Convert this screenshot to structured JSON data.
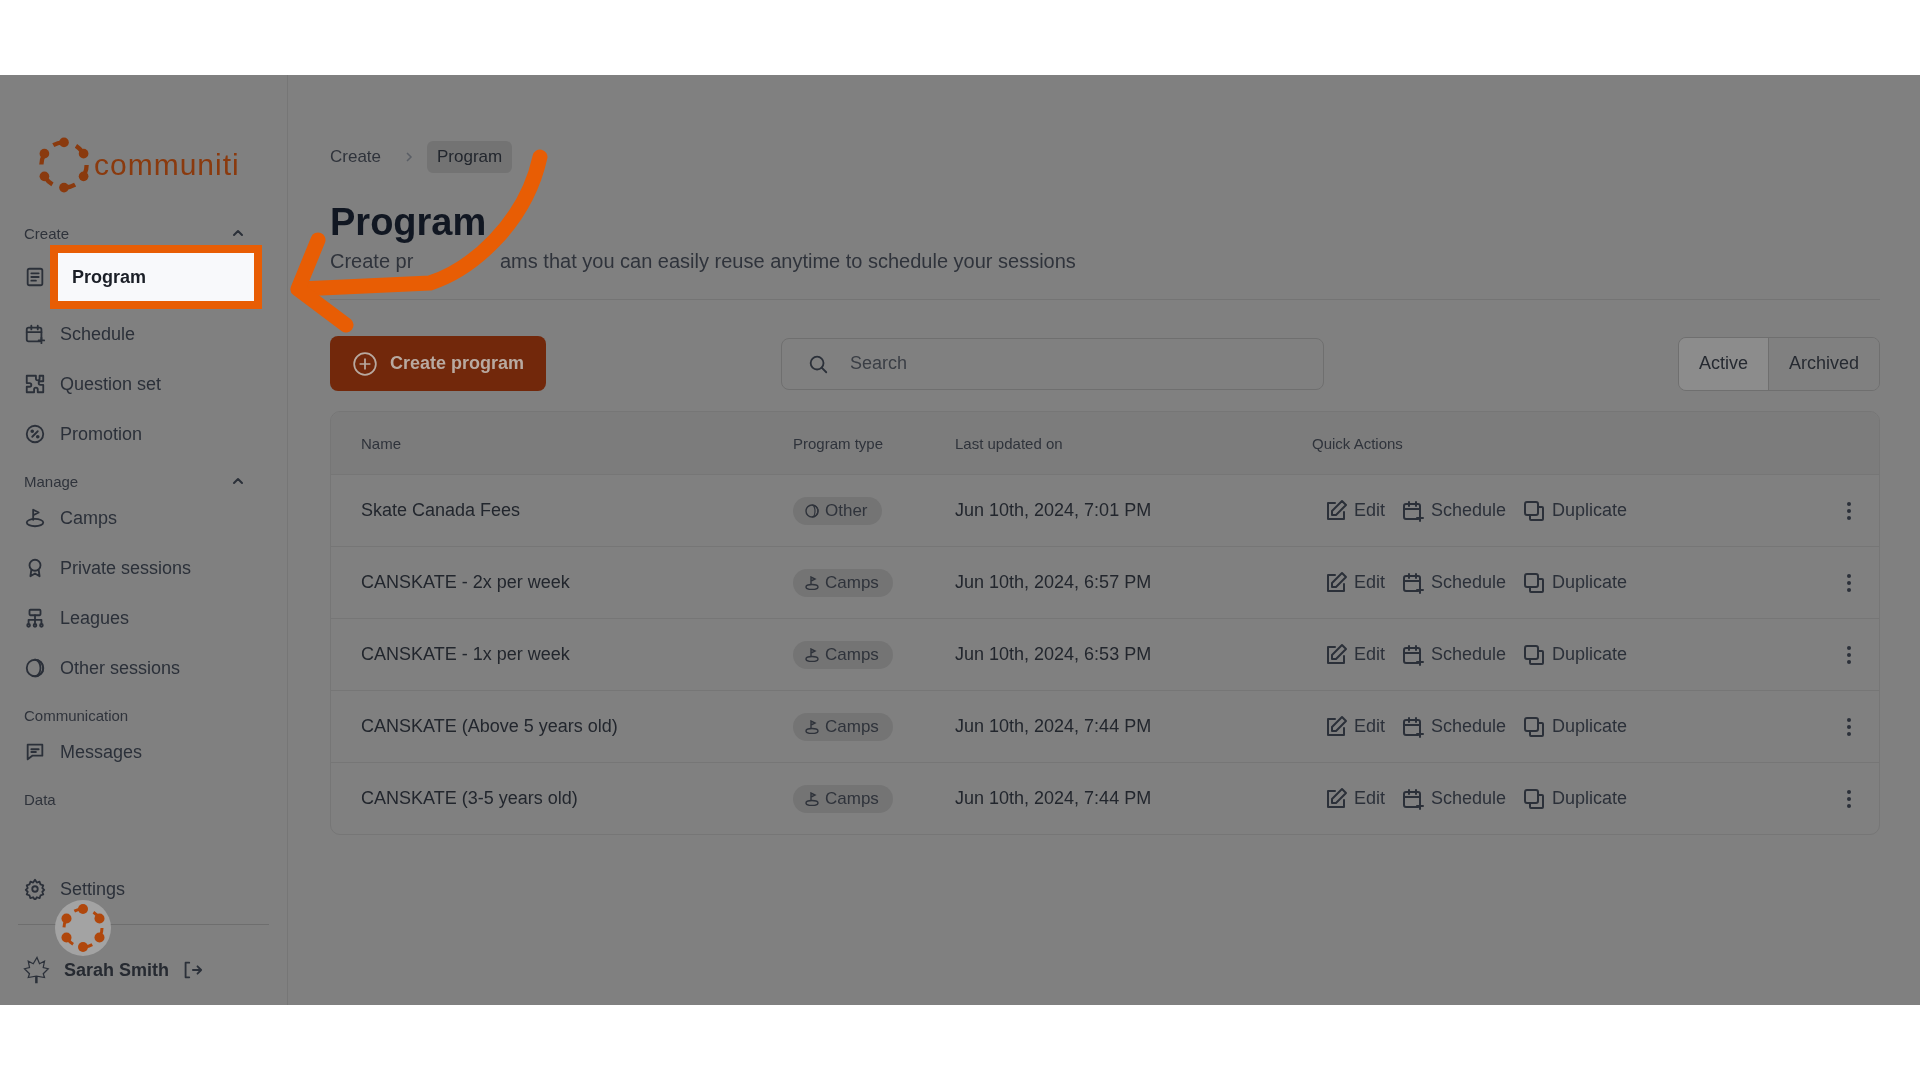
{
  "logo": {
    "text": "communiti"
  },
  "sidebar": {
    "sections": [
      {
        "label": "Create",
        "expanded": true,
        "items": [
          {
            "label": "Program",
            "selected": true
          },
          {
            "label": "Schedule",
            "selected": false
          },
          {
            "label": "Question set",
            "selected": false
          },
          {
            "label": "Promotion",
            "selected": false
          }
        ]
      },
      {
        "label": "Manage",
        "expanded": true,
        "items": [
          {
            "label": "Camps",
            "selected": false
          },
          {
            "label": "Private sessions",
            "selected": false
          },
          {
            "label": "Leagues",
            "selected": false
          },
          {
            "label": "Other sessions",
            "selected": false
          }
        ]
      },
      {
        "label": "Communication",
        "items": [
          {
            "label": "Messages",
            "selected": false
          }
        ]
      },
      {
        "label": "Data"
      }
    ],
    "settings": {
      "label": "Settings"
    },
    "user": {
      "name": "Sarah Smith"
    }
  },
  "breadcrumb": [
    {
      "label": "Create",
      "current": false
    },
    {
      "label": "Program",
      "current": true
    }
  ],
  "page": {
    "title": "Program",
    "subtitle_parts": [
      "Create pr",
      "ams that you can easily reuse anytime to schedule your sessions"
    ]
  },
  "toolbar": {
    "create_button": "Create program",
    "search": {
      "placeholder": "Search"
    },
    "filters": [
      {
        "label": "Active",
        "selected": true
      },
      {
        "label": "Archived",
        "selected": false
      }
    ]
  },
  "table": {
    "columns": [
      "Name",
      "Program type",
      "Last updated on",
      "Quick Actions"
    ],
    "rows": [
      {
        "name": "Skate Canada Fees",
        "type": {
          "kind": "other",
          "label": "Other"
        },
        "updated": "Jun 10th, 2024, 7:01 PM",
        "actions": [
          "Edit",
          "Schedule",
          "Duplicate"
        ]
      },
      {
        "name": "CANSKATE - 2x per week",
        "type": {
          "kind": "camps",
          "label": "Camps"
        },
        "updated": "Jun 10th, 2024, 6:57 PM",
        "actions": [
          "Edit",
          "Schedule",
          "Duplicate"
        ]
      },
      {
        "name": "CANSKATE - 1x per week",
        "type": {
          "kind": "camps",
          "label": "Camps"
        },
        "updated": "Jun 10th, 2024, 6:53 PM",
        "actions": [
          "Edit",
          "Schedule",
          "Duplicate"
        ]
      },
      {
        "name": "CANSKATE (Above 5 years old)",
        "type": {
          "kind": "camps",
          "label": "Camps"
        },
        "updated": "Jun 10th, 2024, 7:44 PM",
        "actions": [
          "Edit",
          "Schedule",
          "Duplicate"
        ]
      },
      {
        "name": "CANSKATE (3-5 years old)",
        "type": {
          "kind": "camps",
          "label": "Camps"
        },
        "updated": "Jun 10th, 2024, 7:44 PM",
        "actions": [
          "Edit",
          "Schedule",
          "Duplicate"
        ]
      }
    ]
  }
}
